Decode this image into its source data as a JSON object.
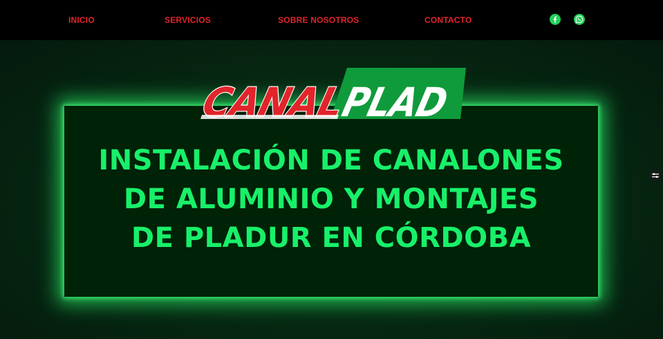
{
  "nav": {
    "items": [
      {
        "label": "INICIO"
      },
      {
        "label": "SERVICIOS"
      },
      {
        "label": "SOBRE NOSOTROS"
      },
      {
        "label": "CONTACTO"
      }
    ],
    "social": [
      {
        "icon": "facebook-icon",
        "color": "#22d05a"
      },
      {
        "icon": "whatsapp-icon",
        "color": "#22d05a"
      }
    ]
  },
  "logo": {
    "part1": "CANAL",
    "part2": "PLAD",
    "red": "#e2242b",
    "green": "#0f9b3b"
  },
  "hero": {
    "lines": [
      "INSTALACIÓN DE CANALONES",
      "DE ALUMINIO Y MONTAJES",
      "DE PLADUR EN CÓRDOBA"
    ],
    "text_color": "#18f06a",
    "glow_color": "#28e664"
  },
  "colors": {
    "nav_bg": "#000000",
    "nav_text": "#e2242b",
    "page_bg": "#041a0d",
    "panel_bg": "#002207"
  }
}
